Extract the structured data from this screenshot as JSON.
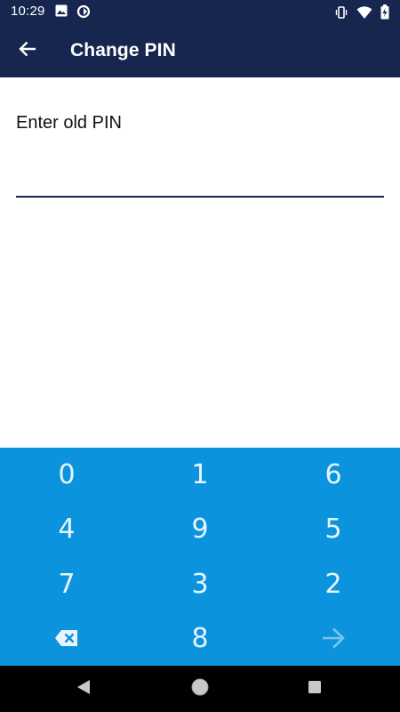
{
  "status_bar": {
    "time": "10:29",
    "icons_left": [
      "image-icon",
      "sync-icon"
    ],
    "icons_right": [
      "vibrate-icon",
      "wifi-icon",
      "battery-icon"
    ]
  },
  "app_bar": {
    "back_icon": "arrow-back-icon",
    "title": "Change PIN",
    "background": "#16264f"
  },
  "form": {
    "prompt": "Enter old PIN",
    "pin_value": "",
    "underline_color": "#16264f"
  },
  "keypad": {
    "background": "#0b93dd",
    "rows": [
      [
        "0",
        "1",
        "6"
      ],
      [
        "4",
        "9",
        "5"
      ],
      [
        "7",
        "3",
        "2"
      ]
    ],
    "bottom_row": {
      "left_icon": "backspace-icon",
      "center": "8",
      "right_icon": "arrow-forward-icon"
    }
  },
  "nav_bar": {
    "icons": [
      "back-triangle-icon",
      "home-circle-icon",
      "recents-square-icon"
    ]
  }
}
